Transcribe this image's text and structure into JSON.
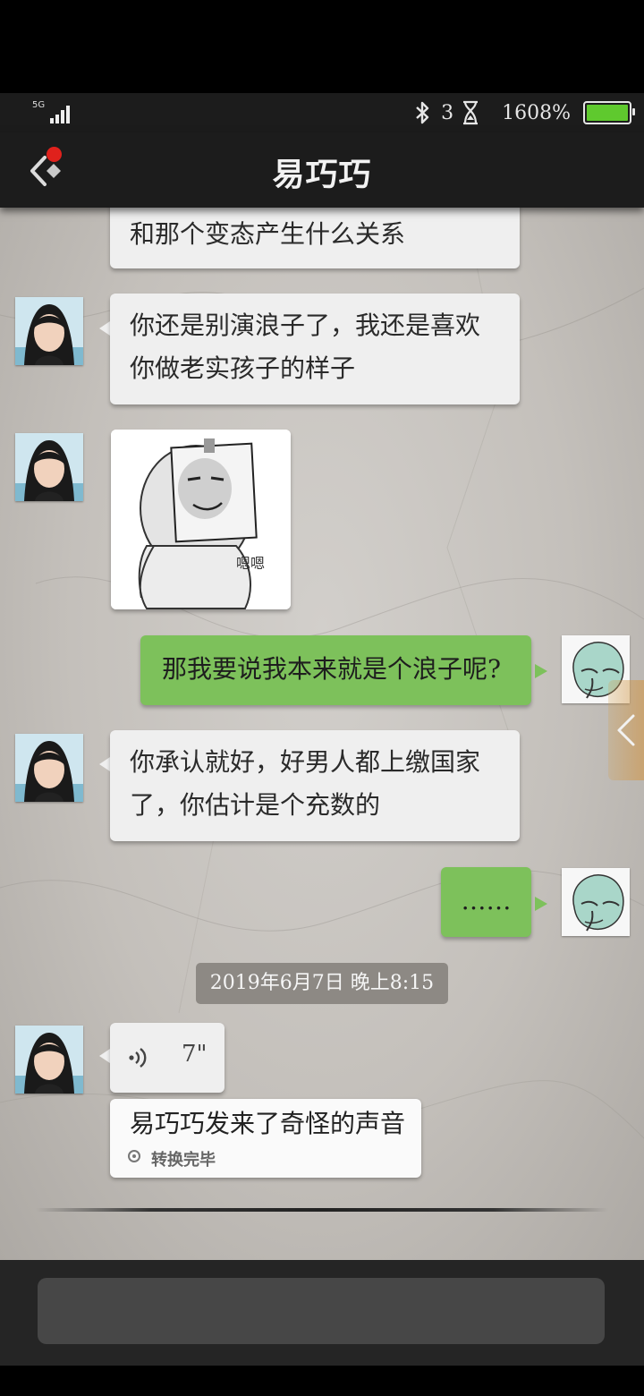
{
  "status_bar": {
    "network": "5G",
    "notification_count": "3",
    "battery_text": "1608%",
    "battery_color": "#5fc92e"
  },
  "header": {
    "title": "易巧巧",
    "back_icon": "back-arrow-icon",
    "badge_color": "#e0211c"
  },
  "messages": [
    {
      "sender": "contact",
      "text": "和那个变态产生什么关系"
    },
    {
      "sender": "contact",
      "lines": [
        "你还是别演浪子了，我还是喜欢",
        "你做老实孩子的样子"
      ]
    },
    {
      "sender": "contact",
      "type": "sticker",
      "sticker_text": "嗯嗯"
    },
    {
      "sender": "me",
      "text": "那我要说我本来就是个浪子呢?"
    },
    {
      "sender": "contact",
      "lines": [
        "你承认就好，好男人都上缴国家",
        "了，你估计是个充数的"
      ]
    },
    {
      "sender": "me",
      "text": "……"
    }
  ],
  "timestamp": "2019年6月7日 晚上8:15",
  "voice_message": {
    "duration": "7\"",
    "icon": "voice-wave-icon",
    "transcript": "易巧巧发来了奇怪的声音",
    "status": "转换完毕"
  },
  "colors": {
    "my_bubble": "#7dc15b",
    "their_bubble": "#efefef"
  }
}
